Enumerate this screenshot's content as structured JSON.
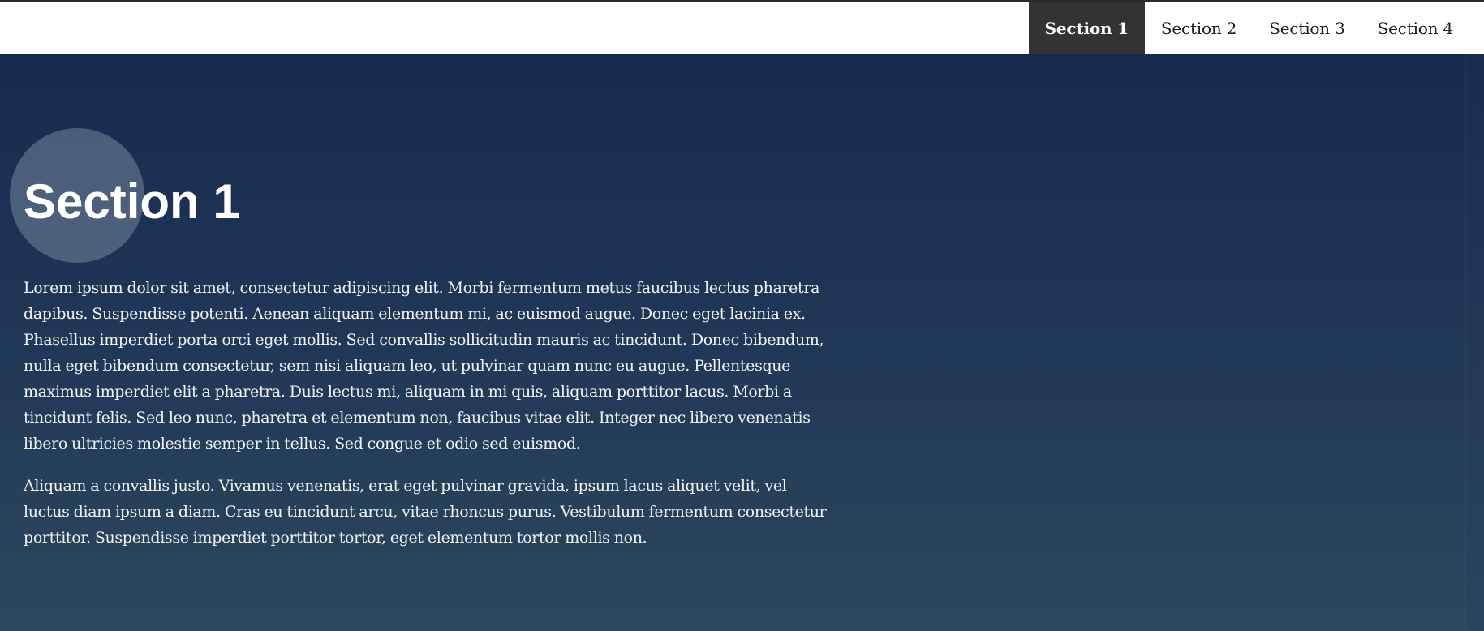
{
  "nav": {
    "items": [
      {
        "label": "Section 1",
        "active": true
      },
      {
        "label": "Section 2",
        "active": false
      },
      {
        "label": "Section 3",
        "active": false
      },
      {
        "label": "Section 4",
        "active": false
      }
    ]
  },
  "section": {
    "title": "Section 1",
    "paragraphs": [
      "Lorem ipsum dolor sit amet, consectetur adipiscing elit. Morbi fermentum metus faucibus lectus pharetra dapibus. Suspendisse potenti. Aenean aliquam elementum mi, ac euismod augue. Donec eget lacinia ex. Phasellus imperdiet porta orci eget mollis. Sed convallis sollicitudin mauris ac tincidunt. Donec bibendum, nulla eget bibendum consectetur, sem nisi aliquam leo, ut pulvinar quam nunc eu augue. Pellentesque maximus imperdiet elit a pharetra. Duis lectus mi, aliquam in mi quis, aliquam porttitor lacus. Morbi a tincidunt felis. Sed leo nunc, pharetra et elementum non, faucibus vitae elit. Integer nec libero venenatis libero ultricies molestie semper in tellus. Sed congue et odio sed euismod.",
      "Aliquam a convallis justo. Vivamus venenatis, erat eget pulvinar gravida, ipsum lacus aliquet velit, vel luctus diam ipsum a diam. Cras eu tincidunt arcu, vitae rhoncus purus. Vestibulum fermentum consectetur porttitor. Suspendisse imperdiet porttitor tortor, eget elementum tortor mollis non."
    ]
  },
  "colors": {
    "nav_active_bg": "#333333",
    "hero_top": "#172a4e",
    "hero_bottom": "#2c475d",
    "title_rule": "#b6c84e"
  }
}
